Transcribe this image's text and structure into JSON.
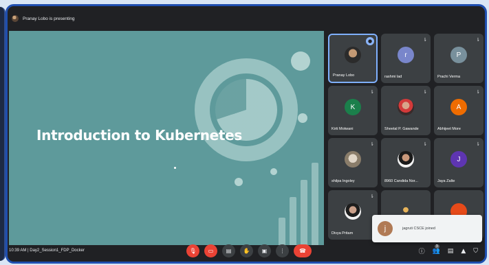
{
  "topbar": {
    "presenting_text": "Pranay Lobo is presenting"
  },
  "slide": {
    "title": "Introduction to Kubernetes"
  },
  "participants": [
    {
      "name": "Pranay Lobo",
      "type": "photo",
      "pinned": true
    },
    {
      "name": "rashmi lad",
      "initial": "r",
      "color": "#7986cb"
    },
    {
      "name": "Prachi Verma",
      "initial": "P",
      "color": "#78909c"
    },
    {
      "name": "Kirti Motwani",
      "initial": "K",
      "color": "#1b7f4b"
    },
    {
      "name": "Sheetal P. Gawande",
      "type": "photo"
    },
    {
      "name": "Abhijeet More",
      "initial": "A",
      "color": "#ef6c00"
    },
    {
      "name": "shilpa Ingoley",
      "type": "photo"
    },
    {
      "name": "8960 Candida Nor...",
      "type": "photo"
    },
    {
      "name": "Jaya Zalte",
      "initial": "J",
      "color": "#5e35b1"
    },
    {
      "name": "Divya Pritam",
      "type": "photo"
    },
    {
      "name": "",
      "type": "photo"
    },
    {
      "name": "",
      "initial": "",
      "color": "#e64a19"
    }
  ],
  "toast": {
    "initial": "j",
    "message": "jagruti CSCE joined"
  },
  "bottombar": {
    "meeting_info": "10:39 AM  |  Day2_Session1_FDP_Docker",
    "participants_badge": "3"
  },
  "icons": {
    "mic": "mic-icon",
    "camera": "camera-icon",
    "captions": "captions-icon",
    "raise_hand": "raise-hand-icon",
    "present": "present-icon",
    "more": "more-vert-icon",
    "end_call": "end-call-icon",
    "info": "info-icon",
    "people": "people-icon",
    "chat": "chat-icon",
    "activities": "activities-icon",
    "host": "shield-icon"
  },
  "colors": {
    "accent": "#1f4fb0",
    "slide_bg": "#5e9a9b",
    "end_call": "#ea4335"
  }
}
